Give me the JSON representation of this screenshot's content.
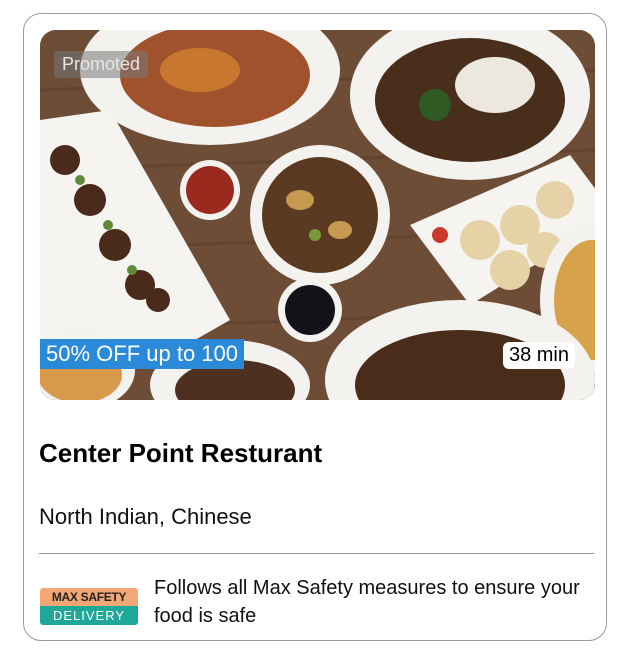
{
  "restaurant": {
    "name": "Center Point Resturant",
    "cuisine": "North Indian, Chinese"
  },
  "hero": {
    "promoted_label": "Promoted",
    "offer_label": "50% OFF up to 100",
    "eta_label": "38 min"
  },
  "safety": {
    "badge_top": "MAX SAFETY",
    "badge_bottom": "DELIVERY",
    "message": "Follows all Max Safety measures to ensure your food is safe"
  },
  "colors": {
    "offer_bg": "#2b8ad8",
    "badge_top_bg": "#f2a774",
    "badge_bottom_bg": "#1fa79a"
  }
}
